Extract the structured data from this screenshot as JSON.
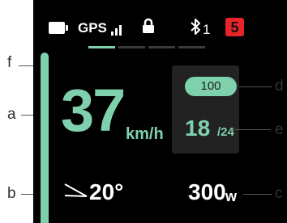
{
  "status_bar": {
    "gps_label": "GPS",
    "bluetooth_count": "1",
    "notification_badge": "5",
    "page_indicator_active": 1,
    "page_indicator_count": 4
  },
  "speed": {
    "value": "37",
    "unit": "km/h"
  },
  "info_panel": {
    "assist_value": "100",
    "trip_current": "18",
    "trip_total": "/24"
  },
  "temperature": {
    "value": "20°"
  },
  "power": {
    "value": "300",
    "unit": "w"
  },
  "callouts": {
    "f": "f",
    "a": "a",
    "b": "b",
    "c": "c",
    "d": "d",
    "e": "e"
  },
  "colors": {
    "accent": "#7fd1ad",
    "background": "#000000",
    "panel": "#222222",
    "badge": "#e8242b",
    "indicator_inactive": "#3a3a3a"
  },
  "icons": {
    "battery": "battery-icon",
    "gps_signal": "signal-bars-icon",
    "lock": "lock-icon",
    "bluetooth": "bluetooth-icon",
    "temperature": "temperature-indicator-icon"
  }
}
